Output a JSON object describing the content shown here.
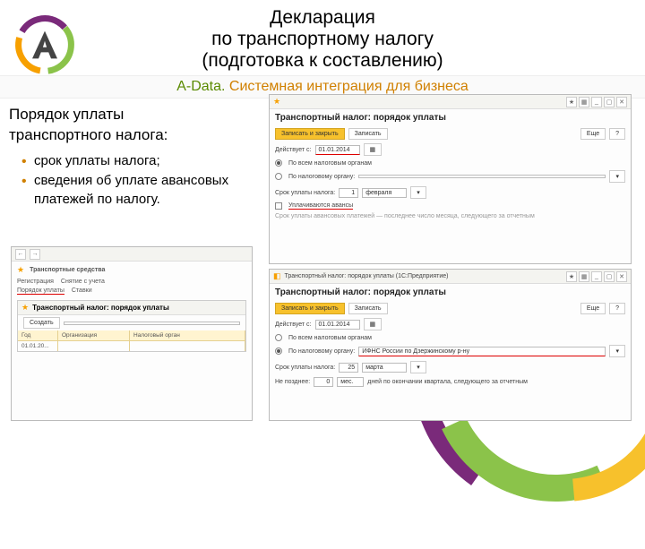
{
  "header": {
    "title_l1": "Декларация",
    "title_l2": "по транспортному налогу",
    "title_l3": "(подготовка к составлению)",
    "brand": "A-Data.",
    "tagline": "Системная интеграция для бизнеса"
  },
  "left": {
    "heading_l1": "Порядок уплаты",
    "heading_l2": "транспортного налога:",
    "bullets": [
      "срок уплаты налога;",
      "сведения об уплате авансовых платежей по налогу."
    ]
  },
  "shot1": {
    "crumb_icon": "★",
    "crumb": "Транспортные средства",
    "sub_crumb_icon": "★",
    "sub_crumb": "Транспортный налог: порядок уплаты",
    "tbl": {
      "h1": "Год",
      "h2": "Организация",
      "h3": "Налоговый орган",
      "r1c1": "01.01.20...",
      "r1c2": "",
      "r1c3": ""
    }
  },
  "shot2": {
    "title": "Транспортный налог: порядок уплаты",
    "btn_save": "Записать и закрыть",
    "btn_write": "Записать",
    "more": "Еще",
    "q": "?",
    "date_lbl": "Действует с:",
    "date_val": "01.01.2014",
    "radio1": "По всем налоговым органам",
    "radio2": "По налоговому органу:",
    "term_lbl": "Срок уплаты налога:",
    "term_day": "1",
    "term_month": "февраля",
    "adv_chk": "Уплачиваются авансы",
    "adv_lbl": "Срок уплаты авансовых платежей — последнее число месяца, следующего за отчетным"
  },
  "shot3": {
    "toolbar_title": "Транспортный налог: порядок уплаты (1С:Предприятие)",
    "title": "Транспортный налог: порядок уплаты",
    "btn_save": "Записать и закрыть",
    "btn_write": "Записать",
    "more": "Еще",
    "q": "?",
    "date_lbl": "Действует с:",
    "date_val": "01.01.2014",
    "radio1": "По всем налоговым органам",
    "radio2": "По налоговому органу:",
    "org_val": "ИФНС России по Дзержинскому р-ну",
    "term_lbl": "Срок уплаты налога:",
    "term_day": "25",
    "term_month": "марта",
    "adv_lbl": "Не позднее:",
    "adv_day": "0",
    "adv_unit": "мес.",
    "adv_tail": "дней по окончании квартала, следующего за отчетным"
  }
}
